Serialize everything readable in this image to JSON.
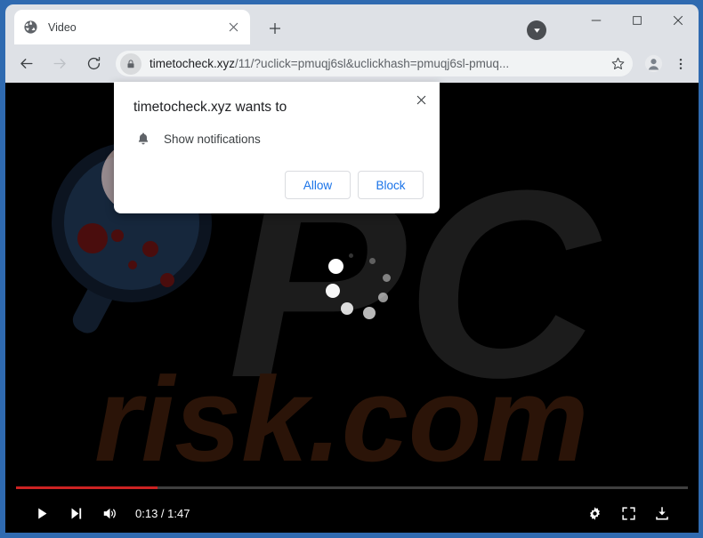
{
  "window": {
    "border_color": "#2f6ab0",
    "chrome_bg": "#dee1e6",
    "minimize_label": "Minimize",
    "maximize_label": "Maximize",
    "close_label": "Close"
  },
  "tab": {
    "title": "Video",
    "favicon_name": "globe-icon",
    "close_label": "Close tab",
    "new_tab_label": "New Tab"
  },
  "toolbar": {
    "back_label": "Back",
    "forward_label": "Forward",
    "reload_label": "Reload",
    "url_domain": "timetocheck.xyz",
    "url_path": "/11/?uclick=pmuqj6sl&uclickhash=pmuqj6sl-pmuq...",
    "url_full": "timetocheck.xyz/11/?uclick=pmuqj6sl&uclickhash=pmuqj6sl-pmuq...",
    "lock_icon_name": "lock-icon",
    "bookmark_label": "Bookmark this tab",
    "profile_label": "Profile",
    "menu_label": "Customize and control Google Chrome",
    "download_bubble_label": "Downloads"
  },
  "permission_dialog": {
    "title": "timetocheck.xyz wants to",
    "permission_label": "Show notifications",
    "permission_icon_name": "bell-icon",
    "allow_label": "Allow",
    "block_label": "Block",
    "close_label": "Close",
    "accent_color": "#1a73e8",
    "background": "#ffffff"
  },
  "video": {
    "background": "#000000",
    "watermark_text_top": "PC",
    "watermark_text_bottom": "risk.com",
    "watermark_color_top": "#1b1b1b",
    "watermark_color_bottom": "#2a1409",
    "loading_indicator_name": "loading-spinner",
    "controls": {
      "play_label": "Play",
      "next_label": "Next",
      "volume_label": "Mute",
      "time_current": "0:13",
      "time_total": "1:47",
      "time_display": "0:13 / 1:47",
      "settings_label": "Settings",
      "fullscreen_label": "Full screen",
      "download_label": "Download",
      "progress_percent": 21,
      "progress_color": "#cc2222",
      "track_color": "#3f3f3f"
    }
  }
}
